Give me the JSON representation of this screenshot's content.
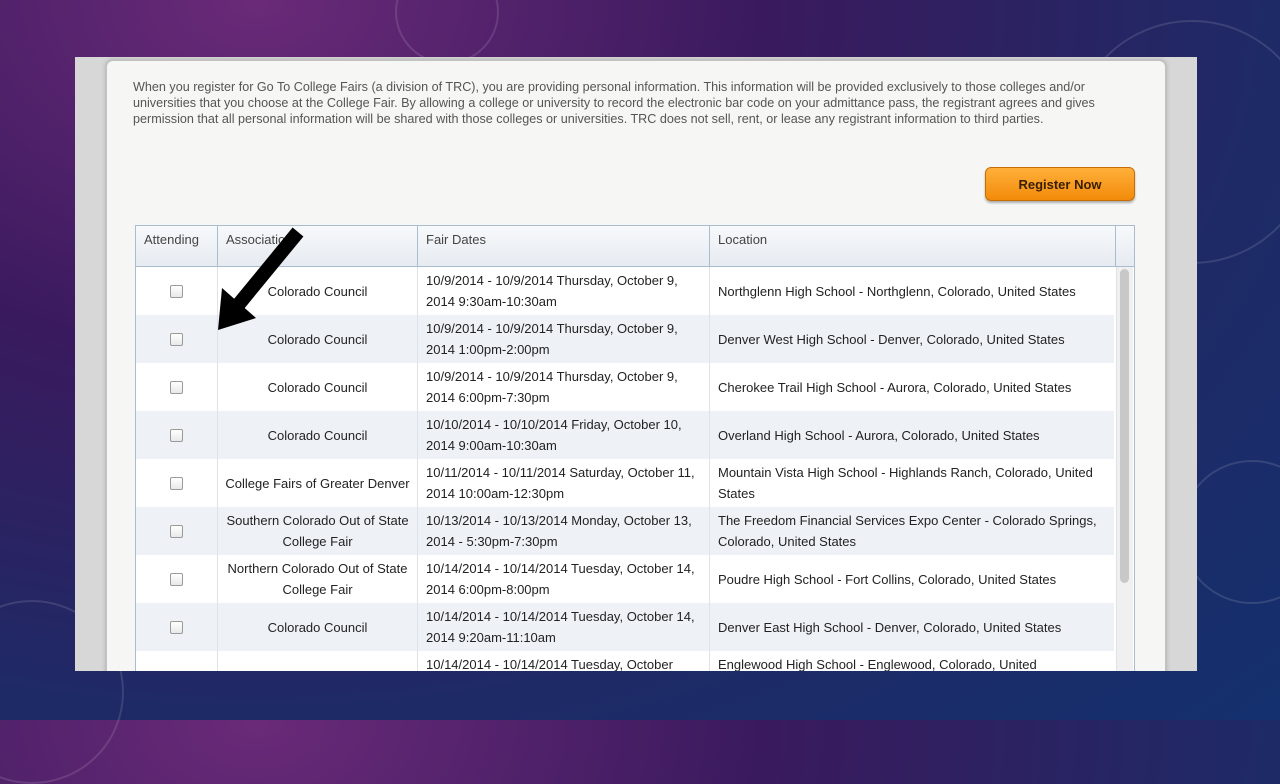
{
  "notice": "When you register for Go To College Fairs (a division of TRC), you are providing personal information. This information will be provided exclusively to those colleges and/or universities that you choose at the College Fair. By allowing a college or university to record the electronic bar code on your admittance pass, the registrant agrees and gives permission that all personal information will be shared with those colleges or universities. TRC does not sell, rent, or lease any registrant information to third parties.",
  "register_label": "Register Now",
  "columns": {
    "attending": "Attending",
    "association": "Association",
    "dates": "Fair Dates",
    "location": "Location"
  },
  "rows": [
    {
      "association": "Colorado Council",
      "dates": "10/9/2014 - 10/9/2014 Thursday, October 9, 2014 9:30am-10:30am",
      "location": "Northglenn High School - Northglenn, Colorado, United States"
    },
    {
      "association": "Colorado Council",
      "dates": "10/9/2014 - 10/9/2014 Thursday, October 9, 2014 1:00pm-2:00pm",
      "location": "Denver West High School - Denver, Colorado, United States"
    },
    {
      "association": "Colorado Council",
      "dates": "10/9/2014 - 10/9/2014 Thursday, October 9, 2014 6:00pm-7:30pm",
      "location": "Cherokee Trail High School - Aurora, Colorado, United States"
    },
    {
      "association": "Colorado Council",
      "dates": "10/10/2014 - 10/10/2014 Friday, October 10, 2014 9:00am-10:30am",
      "location": "Overland High School - Aurora, Colorado, United States"
    },
    {
      "association": "College Fairs of Greater Denver",
      "dates": "10/11/2014 - 10/11/2014 Saturday, October 11, 2014 10:00am-12:30pm",
      "location": "Mountain Vista High School - Highlands Ranch, Colorado, United States"
    },
    {
      "association": "Southern Colorado Out of State College Fair",
      "dates": "10/13/2014 - 10/13/2014 Monday, October 13, 2014 - 5:30pm-7:30pm",
      "location": "The Freedom Financial Services Expo Center - Colorado Springs, Colorado, United States"
    },
    {
      "association": "Northern Colorado Out of State College Fair",
      "dates": "10/14/2014 - 10/14/2014 Tuesday, October 14, 2014 6:00pm-8:00pm",
      "location": "Poudre High School - Fort Collins, Colorado, United States"
    },
    {
      "association": "Colorado Council",
      "dates": "10/14/2014 - 10/14/2014 Tuesday, October 14, 2014 9:20am-11:10am",
      "location": "Denver East High School - Denver, Colorado, United States"
    },
    {
      "association": "",
      "dates": "10/14/2014 - 10/14/2014 Tuesday, October",
      "location": "Englewood High School - Englewood, Colorado, United"
    }
  ]
}
